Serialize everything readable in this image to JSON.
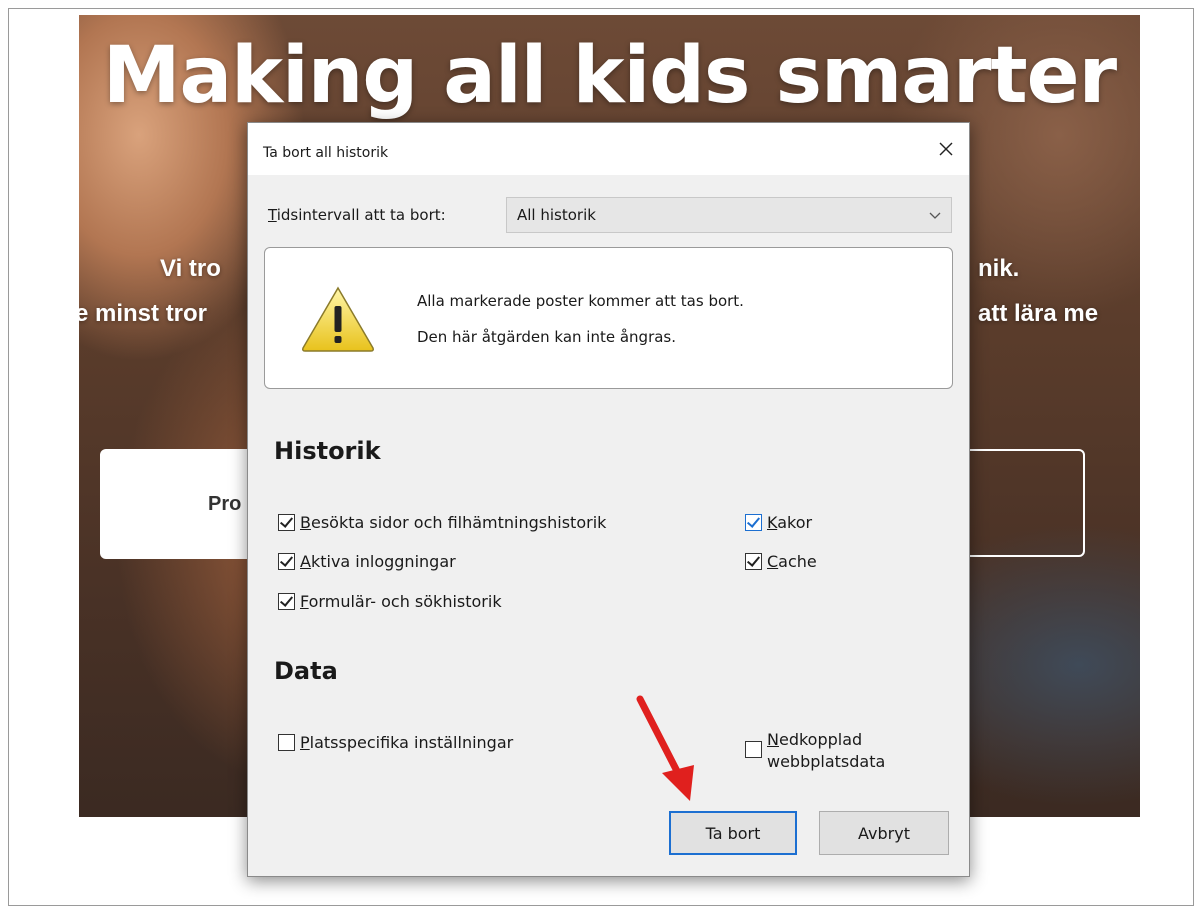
{
  "background_page": {
    "headline": "Making all kids smarter",
    "line1_left": "Vi tro",
    "line1_right": "nik.",
    "line2_left": "e minst tror",
    "line2_right": "att lära me",
    "button_left_text": "Pro"
  },
  "dialog": {
    "title": "Ta bort all historik",
    "interval_label_prefix": "T",
    "interval_label_rest": "idsintervall att ta bort:",
    "interval_value": "All historik",
    "warning_line1": "Alla markerade poster kommer att tas bort.",
    "warning_line2": "Den här åtgärden kan inte ångras.",
    "history_heading": "Historik",
    "data_heading": "Data",
    "history_items": [
      {
        "key": "B",
        "rest": "esökta sidor och filhämtningshistorik",
        "checked": true
      },
      {
        "key": "A",
        "rest": "ktiva inloggningar",
        "checked": true
      },
      {
        "key": "F",
        "rest": "ormulär- och sökhistorik",
        "checked": true
      },
      {
        "key": "K",
        "rest": "akor",
        "checked": true
      },
      {
        "key": "C",
        "rest": "ache",
        "checked": true
      }
    ],
    "data_items": [
      {
        "key": "P",
        "rest": "latsspecifika inställningar",
        "checked": false
      },
      {
        "key": "N",
        "rest": "edkopplad",
        "rest2": "webbplatsdata",
        "checked": false
      }
    ],
    "delete_button": "Ta bort",
    "cancel_button": "Avbryt"
  },
  "colors": {
    "accent": "#1c6fd1",
    "annotation_arrow": "#e0201e",
    "dialog_bg": "#f0f0f0"
  },
  "icons": [
    "close-icon",
    "chevron-down-icon",
    "warning-icon",
    "checkbox-icon",
    "red-arrow-annotation"
  ]
}
